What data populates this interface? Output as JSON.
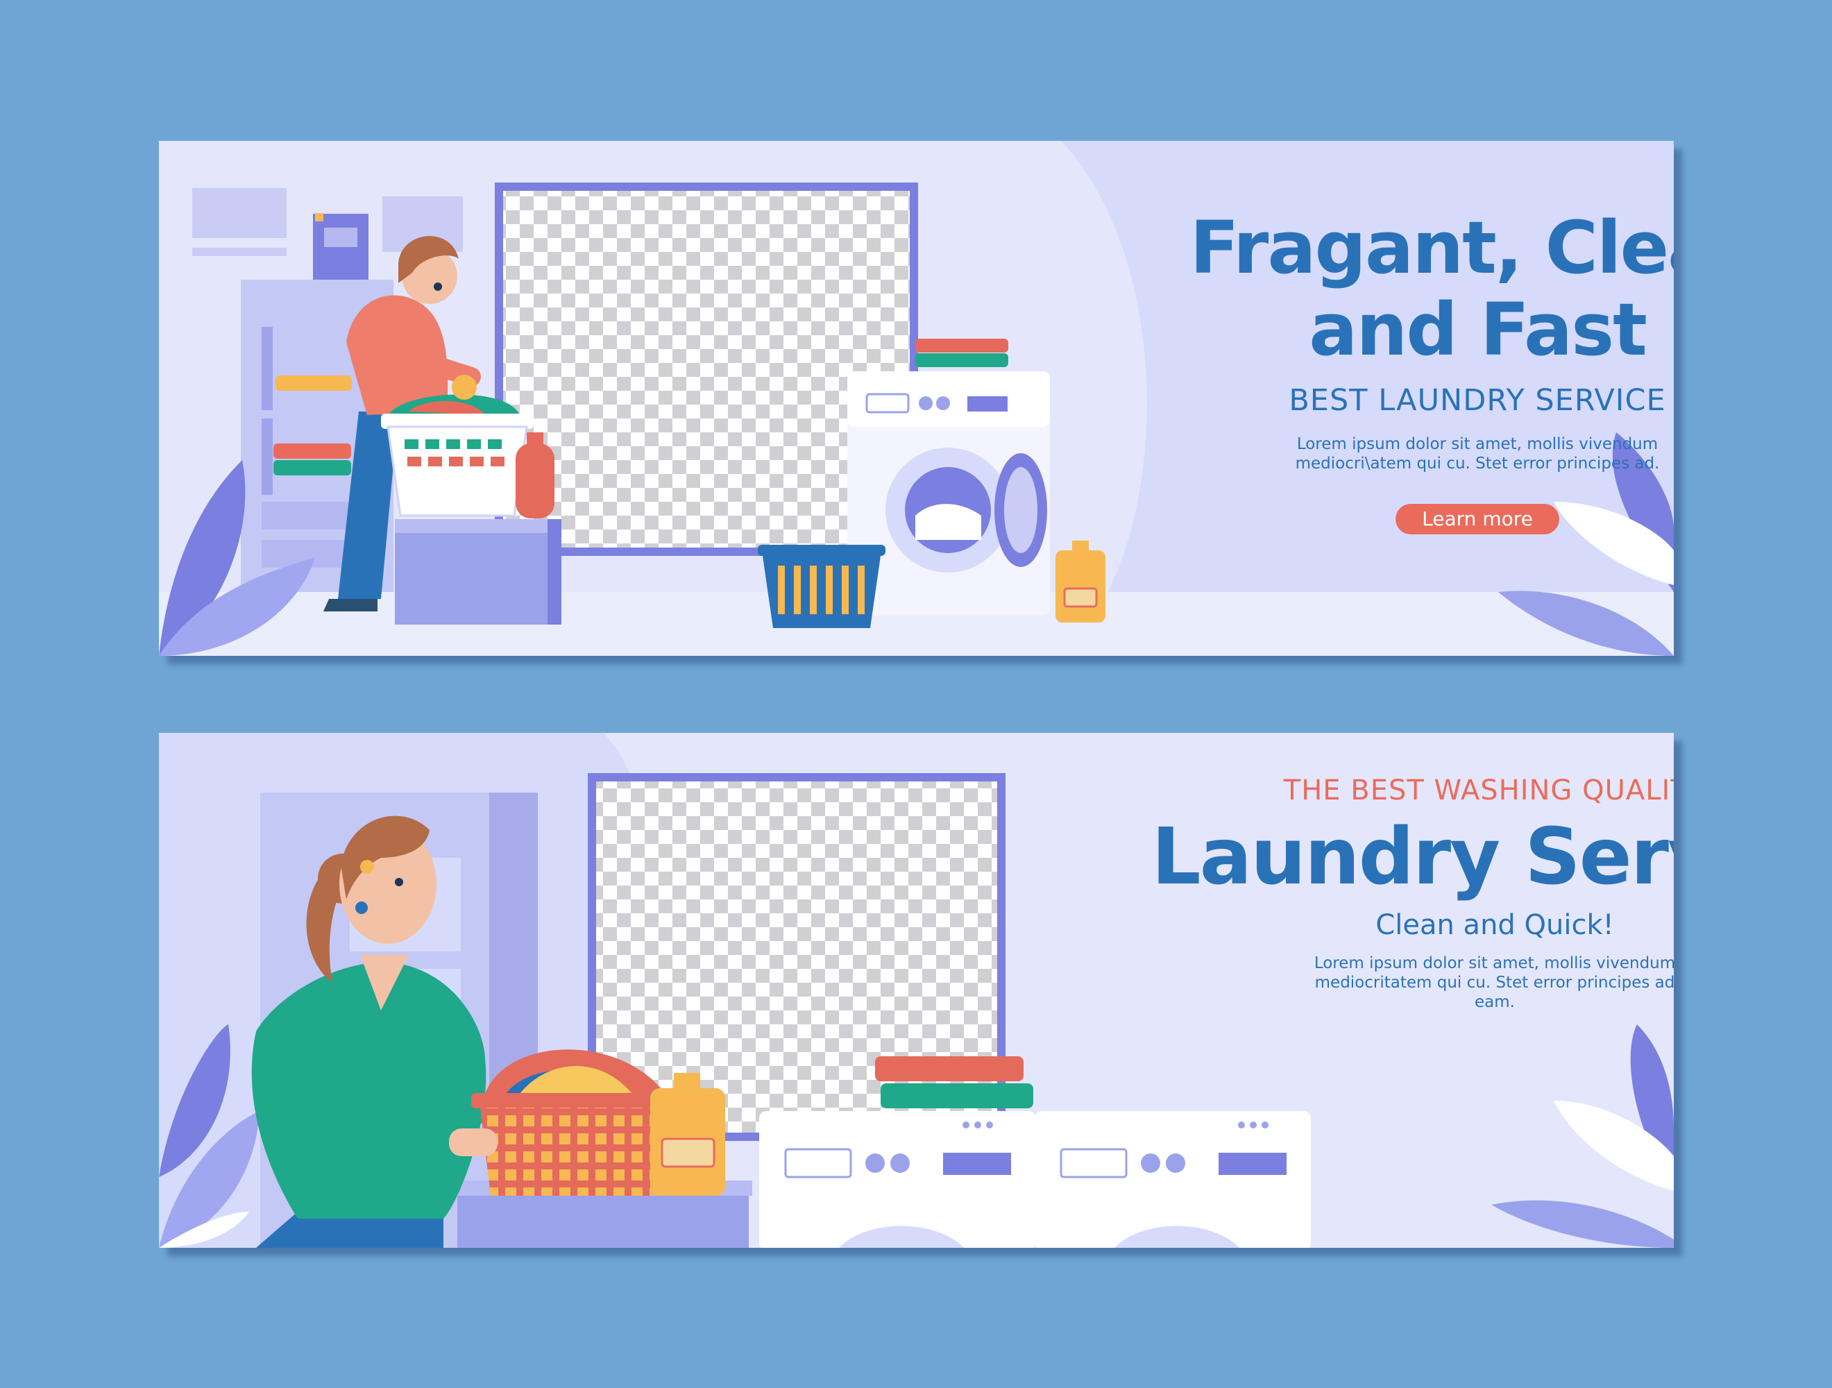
{
  "banners": [
    {
      "headline": "Fragant, Clean and Fast",
      "subheading": "BEST LAUNDRY SERVICE",
      "body": "Lorem ipsum dolor sit amet, mollis vivendum mediocri\\atem qui cu. Stet error principes ad.",
      "cta_label": "Learn more"
    },
    {
      "eyebrow": "THE BEST WASHING QUALITY",
      "headline": "Laundry Service",
      "subheading": "Clean and Quick!",
      "body": "Lorem ipsum dolor sit amet, mollis vivendum mediocritatem qui cu. Stet error principes ad eam."
    }
  ],
  "colors": {
    "page_background": "#6fa5d4",
    "banner_background": "#e4e7fb",
    "headline": "#2a72b8",
    "accent": "#ea6b5c",
    "frame": "#7b7fe0"
  },
  "icons": [
    "leaf-icon",
    "laundry-basket-icon",
    "washing-machine-icon",
    "detergent-bottle-icon",
    "folded-towels-icon"
  ]
}
